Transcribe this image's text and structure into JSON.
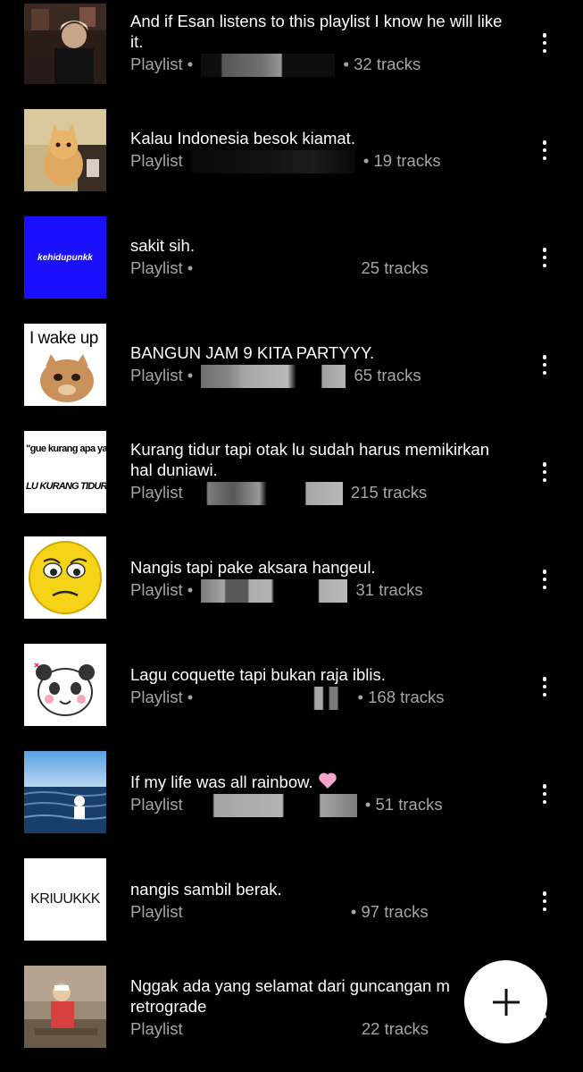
{
  "playlists": [
    {
      "title": "And if Esan listens to this playlist I know he will like it.",
      "type": "Playlist",
      "sep": "•",
      "tracks": "32 tracks",
      "thumb": "person-photo"
    },
    {
      "title": "Kalau Indonesia besok kiamat.",
      "type": "Playlist",
      "sep": "•",
      "tracks": "19 tracks",
      "thumb": "cat-photo"
    },
    {
      "title": "sakit sih.",
      "type": "Playlist",
      "sep": "•",
      "tracks": "25 tracks",
      "thumb_text": "kehidupunkk"
    },
    {
      "title": "BANGUN JAM 9 KITA PARTYYY.",
      "type": "Playlist",
      "sep": "•",
      "tracks": "65 tracks",
      "thumb_text": "I wake up"
    },
    {
      "title": "Kurang tidur tapi otak lu sudah harus memikirkan hal duniawi.",
      "type": "Playlist",
      "sep": "•",
      "tracks": "215 tracks",
      "thumb_text_1": "\"gue kurang apa ya?\"",
      "thumb_text_2": "LU KURANG TIDUR"
    },
    {
      "title": "Nangis tapi pake aksara hangeul.",
      "type": "Playlist",
      "sep": "•",
      "tracks": "31 tracks",
      "thumb": "sad-emoji"
    },
    {
      "title": "Lagu coquette tapi bukan raja iblis.",
      "type": "Playlist",
      "sep": "•",
      "tracks": "168 tracks",
      "thumb": "panda-sticker"
    },
    {
      "title": "If my life was all rainbow. 🩷",
      "title_text": "If my life was all rainbow.",
      "type": "Playlist",
      "sep": "•",
      "tracks": "51 tracks",
      "thumb": "sea-photo"
    },
    {
      "title": "nangis sambil berak.",
      "type": "Playlist",
      "sep": "•",
      "tracks": "97 tracks",
      "thumb_text": "KRIUUKKK"
    },
    {
      "title": "Nggak ada yang selamat dari guncangan m retrograde",
      "title_line1": "Nggak ada yang selamat dari guncangan m",
      "title_line2": "retrograde",
      "type": "Playlist",
      "sep": "•",
      "tracks": "22 tracks",
      "thumb": "kid-photo"
    }
  ],
  "icons": {
    "more": "more-vert-icon",
    "fab": "plus-icon",
    "heart": "pink-heart-icon"
  },
  "colors": {
    "background": "#000000",
    "title": "#ffffff",
    "subtitle": "#a5a5a5",
    "fab_bg": "#ffffff",
    "blue_thumb": "#1a10ff",
    "heart": "#f5a6c8"
  }
}
